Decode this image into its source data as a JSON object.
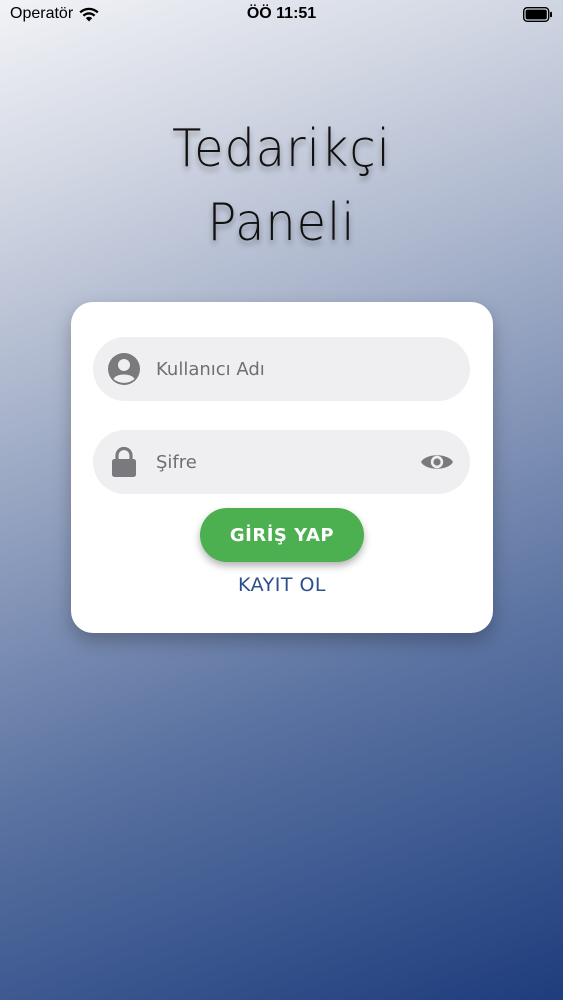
{
  "status_bar": {
    "carrier": "Operatör",
    "time": "ÖÖ 11:51"
  },
  "title": {
    "line1": "Tedarikçi",
    "line2": "Paneli"
  },
  "login_form": {
    "username_placeholder": "Kullanıcı Adı",
    "password_placeholder": "Şifre",
    "login_label": "GİRİŞ YAP",
    "register_label": "KAYIT OL"
  },
  "colors": {
    "primary_button": "#4caf50",
    "link": "#2d4f8e",
    "field_background": "#efeff1",
    "icon_gray": "#7a7a7e"
  },
  "icons": {
    "username": "person-circle-icon",
    "password": "lock-icon",
    "toggle_visibility": "eye-icon"
  }
}
